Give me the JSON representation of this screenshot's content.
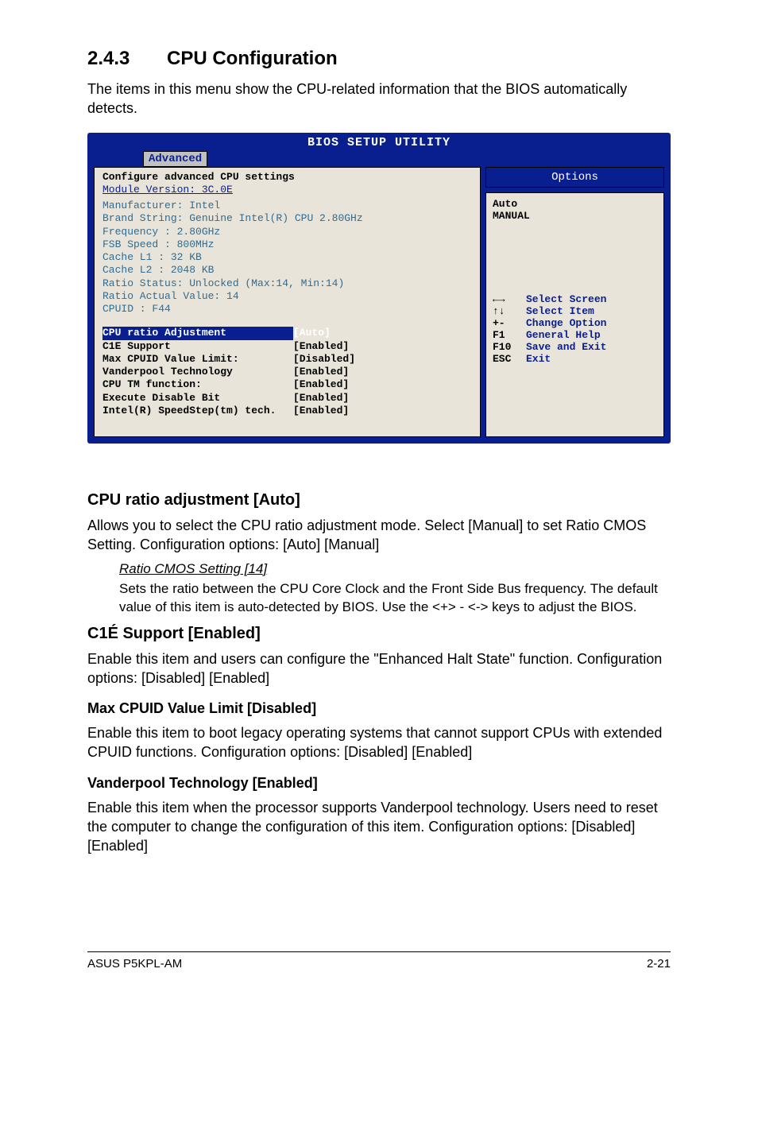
{
  "section": {
    "number": "2.4.3",
    "title": "CPU Configuration"
  },
  "intro": "The items in this menu show the CPU-related information that the BIOS automatically detects.",
  "bios": {
    "title": "BIOS SETUP UTILITY",
    "tab": "Advanced",
    "left_heading1": "Configure advanced CPU settings",
    "left_heading2": "Module Version: 3C.0E",
    "info": [
      "Manufacturer: Intel",
      "Brand String: Genuine Intel(R) CPU 2.80GHz",
      "Frequency   : 2.80GHz",
      "FSB Speed   : 800MHz",
      "Cache L1    : 32 KB",
      "Cache L2    : 2048 KB",
      "Ratio Status: Unlocked (Max:14, Min:14)",
      "Ratio Actual Value: 14",
      "CPUID       : F44"
    ],
    "settings": [
      {
        "label": "CPU ratio Adjustment",
        "value": "[Auto]",
        "highlight": true
      },
      {
        "label": "C1E Support",
        "value": "[Enabled]"
      },
      {
        "label": "Max CPUID Value Limit:",
        "value": "[Disabled]"
      },
      {
        "label": "Vanderpool Technology",
        "value": "[Enabled]"
      },
      {
        "label": "CPU TM function:",
        "value": "[Enabled]"
      },
      {
        "label": "Execute Disable Bit",
        "value": "[Enabled]"
      },
      {
        "label": "Intel(R) SpeedStep(tm) tech.",
        "value": "[Enabled]"
      }
    ],
    "right_top": "Options",
    "right_options": [
      "Auto",
      "MANUAL"
    ],
    "help": [
      {
        "key": "←→",
        "desc": "Select Screen"
      },
      {
        "key": "↑↓",
        "desc": "Select Item"
      },
      {
        "key": "+-",
        "desc": "Change Option"
      },
      {
        "key": "F1",
        "desc": "General Help"
      },
      {
        "key": "F10",
        "desc": "Save and Exit"
      },
      {
        "key": "ESC",
        "desc": "Exit"
      }
    ]
  },
  "content": {
    "h_cpu_ratio": "CPU ratio adjustment [Auto]",
    "p_cpu_ratio": "Allows you to select the CPU ratio adjustment mode. Select [Manual] to set Ratio CMOS Setting. Configuration options: [Auto] [Manual]",
    "sub_ratio_title": "Ratio CMOS Setting [14]",
    "sub_ratio_body": "Sets the ratio between the CPU Core Clock and the Front Side Bus frequency. The default value of this item is auto-detected by BIOS. Use the <+> - <-> keys to adjust the BIOS.",
    "h_c1e": "C1É Support [Enabled]",
    "p_c1e": "Enable this item and users can configure the \"Enhanced Halt State\" function. Configuration options: [Disabled] [Enabled]",
    "h_cpuid": "Max CPUID Value Limit [Disabled]",
    "p_cpuid": "Enable this item to boot legacy operating systems that cannot support CPUs with extended CPUID functions. Configuration options: [Disabled] [Enabled]",
    "h_vander": "Vanderpool Technology [Enabled]",
    "p_vander": "Enable this item when the processor supports Vanderpool technology. Users need to reset the computer to change the configuration of this item. Configuration options: [Disabled] [Enabled]"
  },
  "footer": {
    "left": "ASUS P5KPL-AM",
    "right": "2-21"
  }
}
